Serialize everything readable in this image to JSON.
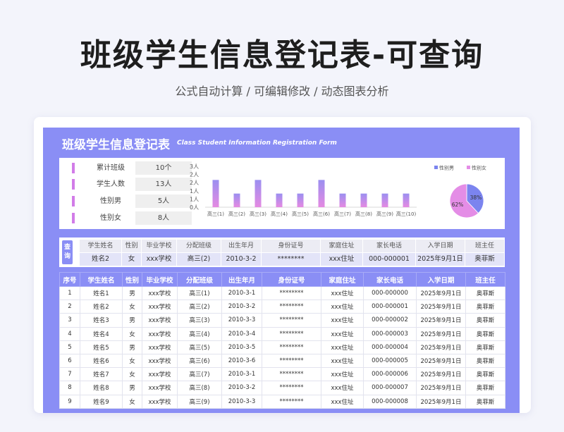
{
  "hero": {
    "title": "班级学生信息登记表-可查询",
    "subtitle": "公式自动计算 /  可编辑修改  / 动态图表分析"
  },
  "sheet": {
    "title": "班级学生信息登记表",
    "title_en": "Class Student Information Registration Form"
  },
  "stats": [
    {
      "label": "累计班级",
      "value": "10个"
    },
    {
      "label": "学生人数",
      "value": "13人"
    },
    {
      "label": "性别男",
      "value": "5人"
    },
    {
      "label": "性别女",
      "value": "8人"
    }
  ],
  "chart_data": [
    {
      "type": "bar",
      "categories": [
        "高三(1)",
        "高三(2)",
        "高三(3)",
        "高三(4)",
        "高三(5)",
        "高三(6)",
        "高三(7)",
        "高三(8)",
        "高三(9)",
        "高三(10)"
      ],
      "values": [
        2,
        1,
        2,
        1,
        1,
        2,
        1,
        1,
        1,
        1
      ],
      "yticks": [
        "0人",
        "1人",
        "1人",
        "2人",
        "2人",
        "3人"
      ],
      "ylim": [
        0,
        3
      ],
      "colors": {
        "top": "#9b8ff0",
        "bottom": "#e58ae2"
      }
    },
    {
      "type": "pie",
      "legend": [
        "性别男",
        "性别女"
      ],
      "values": [
        38,
        62
      ],
      "labels": [
        "38%",
        "62%"
      ],
      "colors": [
        "#7b84ef",
        "#e48de6"
      ],
      "legend_position": "top"
    }
  ],
  "query": {
    "button_label": "查询",
    "headers": [
      "学生姓名",
      "性别",
      "毕业学校",
      "分配班级",
      "出生年月",
      "身份证号",
      "家庭住址",
      "家长电话",
      "入学日期",
      "班主任"
    ],
    "values": [
      "姓名2",
      "女",
      "xxx学校",
      "高三(2)",
      "2010-3-2",
      "********",
      "xxx住址",
      "000-000001",
      "2025年9月1日",
      "奥菲斯"
    ]
  },
  "table": {
    "headers": [
      "序号",
      "学生姓名",
      "性别",
      "毕业学校",
      "分配班级",
      "出生年月",
      "身份证号",
      "家庭住址",
      "家长电话",
      "入学日期",
      "班主任"
    ],
    "rows": [
      [
        "1",
        "姓名1",
        "男",
        "xxx学校",
        "高三(1)",
        "2010-3-1",
        "********",
        "xxx住址",
        "000-000000",
        "2025年9月1日",
        "奥菲斯"
      ],
      [
        "2",
        "姓名2",
        "女",
        "xxx学校",
        "高三(2)",
        "2010-3-2",
        "********",
        "xxx住址",
        "000-000001",
        "2025年9月1日",
        "奥菲斯"
      ],
      [
        "3",
        "姓名3",
        "男",
        "xxx学校",
        "高三(3)",
        "2010-3-3",
        "********",
        "xxx住址",
        "000-000002",
        "2025年9月1日",
        "奥菲斯"
      ],
      [
        "4",
        "姓名4",
        "女",
        "xxx学校",
        "高三(4)",
        "2010-3-4",
        "********",
        "xxx住址",
        "000-000003",
        "2025年9月1日",
        "奥菲斯"
      ],
      [
        "5",
        "姓名5",
        "男",
        "xxx学校",
        "高三(5)",
        "2010-3-5",
        "********",
        "xxx住址",
        "000-000004",
        "2025年9月1日",
        "奥菲斯"
      ],
      [
        "6",
        "姓名6",
        "女",
        "xxx学校",
        "高三(6)",
        "2010-3-6",
        "********",
        "xxx住址",
        "000-000005",
        "2025年9月1日",
        "奥菲斯"
      ],
      [
        "7",
        "姓名7",
        "女",
        "xxx学校",
        "高三(7)",
        "2010-3-1",
        "********",
        "xxx住址",
        "000-000006",
        "2025年9月1日",
        "奥菲斯"
      ],
      [
        "8",
        "姓名8",
        "男",
        "xxx学校",
        "高三(8)",
        "2010-3-2",
        "********",
        "xxx住址",
        "000-000007",
        "2025年9月1日",
        "奥菲斯"
      ],
      [
        "9",
        "姓名9",
        "女",
        "xxx学校",
        "高三(9)",
        "2010-3-3",
        "********",
        "xxx住址",
        "000-000008",
        "2025年9月1日",
        "奥菲斯"
      ]
    ]
  }
}
